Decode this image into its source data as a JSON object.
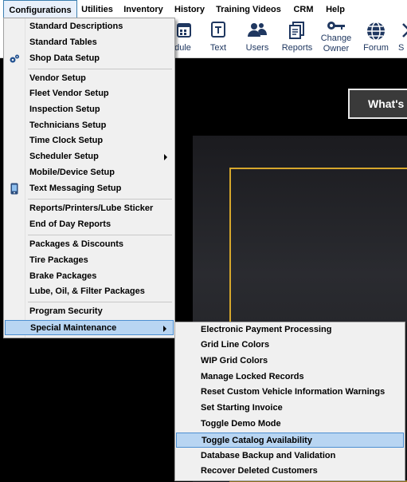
{
  "menubar": {
    "items": [
      "Configurations",
      "Utilities",
      "Inventory",
      "History",
      "Training Videos",
      "CRM",
      "Help"
    ]
  },
  "toolbar": {
    "buttons": [
      {
        "label": "edule",
        "icon": "calendar-icon"
      },
      {
        "label": "Text",
        "icon": "text-message-icon"
      },
      {
        "label": "Users",
        "icon": "users-icon"
      },
      {
        "label": "Reports",
        "icon": "reports-icon"
      },
      {
        "label": "Change Owner",
        "label_line1": "Change",
        "label_line2": "Owner",
        "icon": "change-owner-icon"
      },
      {
        "label": "Forum",
        "icon": "globe-icon"
      },
      {
        "label": "S",
        "icon": "arrow-icon"
      }
    ]
  },
  "banner": {
    "text": "What's"
  },
  "configurations_menu": {
    "items": [
      "Standard Descriptions",
      "Standard Tables",
      "Shop Data Setup",
      "Vendor Setup",
      "Fleet Vendor Setup",
      "Inspection Setup",
      "Technicians Setup",
      "Time Clock Setup",
      "Scheduler Setup",
      "Mobile/Device Setup",
      "Text Messaging Setup",
      "Reports/Printers/Lube Sticker",
      "End of Day Reports",
      "Packages & Discounts",
      "Tire Packages",
      "Brake Packages",
      "Lube, Oil, & Filter Packages",
      "Program Security",
      "Special Maintenance"
    ]
  },
  "special_maintenance_menu": {
    "items": [
      "Electronic Payment Processing",
      "Grid Line Colors",
      "WIP Grid Colors",
      "Manage Locked Records",
      "Reset Custom Vehicle Information Warnings",
      "Set Starting Invoice",
      "Toggle Demo Mode",
      "Toggle Catalog Availability",
      "Database Backup and Validation",
      "Recover Deleted Customers"
    ]
  },
  "colors": {
    "highlight": "#b8d5f2",
    "highlight_border": "#4d8fd1",
    "gold_frame": "#d6a72c",
    "toolbar_icon": "#1f3760"
  }
}
